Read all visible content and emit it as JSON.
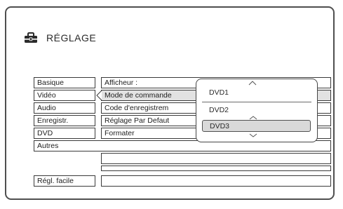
{
  "header": {
    "title": "RÉGLAGE",
    "icon": "toolbox-icon"
  },
  "categories": [
    "Basique",
    "Vidéo",
    "Audio",
    "Enregistr.",
    "DVD"
  ],
  "options": [
    "Afficheur :",
    "Mode de commande",
    "Code d'enregistrem",
    "Réglage Par Defaut",
    "Formater"
  ],
  "extra_rows": [
    "Autres",
    "",
    "Régl. facile"
  ],
  "popup": {
    "items": [
      "DVD1",
      "DVD2",
      "DVD3"
    ],
    "selected": "DVD3"
  }
}
